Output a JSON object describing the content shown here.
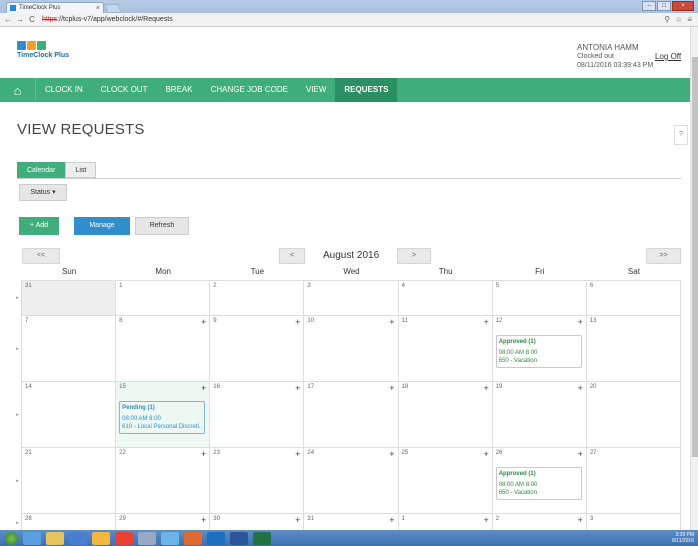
{
  "browser": {
    "tab_title": "TimeClock Plus",
    "url_scheme": "https",
    "url_rest": "://tcplus-v7/app/webclock/#/Requests"
  },
  "header": {
    "logo_text": "TimeClock Plus",
    "user_name": "ANTONIA HAMM",
    "user_status": "Clocked out",
    "datetime": "08/11/2016 03:39:43 PM",
    "logoff": "Log Off"
  },
  "nav": {
    "items": [
      {
        "label": "CLOCK IN"
      },
      {
        "label": "CLOCK OUT"
      },
      {
        "label": "BREAK"
      },
      {
        "label": "CHANGE JOB CODE"
      },
      {
        "label": "VIEW"
      },
      {
        "label": "REQUESTS",
        "active": true
      }
    ]
  },
  "page": {
    "title": "VIEW REQUESTS",
    "help": "?",
    "tabs": [
      {
        "label": "Calendar",
        "active": true
      },
      {
        "label": "List"
      }
    ],
    "status_label": "Status",
    "add_label": "Add",
    "manage_label": "Manage",
    "refresh_label": "Refresh",
    "prev_year": "<<",
    "prev_month": "<",
    "next_month": ">",
    "next_year": ">>",
    "month_title": "August 2016"
  },
  "weekdays": [
    "Sun",
    "Mon",
    "Tue",
    "Wed",
    "Thu",
    "Fri",
    "Sat"
  ],
  "colors": {
    "brand_green": "#3fae7c",
    "manage_blue": "#2f8ecb",
    "approved_green": "#2e8b3d",
    "pending_blue": "#2f8ecb"
  },
  "calendar": {
    "weeks": [
      {
        "days": [
          {
            "n": "31",
            "gray": true
          },
          {
            "n": "1"
          },
          {
            "n": "2"
          },
          {
            "n": "3"
          },
          {
            "n": "4"
          },
          {
            "n": "5"
          },
          {
            "n": "6"
          }
        ]
      },
      {
        "days": [
          {
            "n": "7"
          },
          {
            "n": "8",
            "plus": true
          },
          {
            "n": "9",
            "plus": true
          },
          {
            "n": "10",
            "plus": true
          },
          {
            "n": "11",
            "plus": true
          },
          {
            "n": "12",
            "plus": true,
            "event": {
              "status": "approved",
              "head": "Approved (1)",
              "lines": [
                "08:00 AM 8:00",
                "650 - Vacation"
              ]
            }
          },
          {
            "n": "13"
          }
        ]
      },
      {
        "days": [
          {
            "n": "14"
          },
          {
            "n": "15",
            "plus": true,
            "today": true,
            "event": {
              "status": "pending",
              "head": "Pending (1)",
              "lines": [
                "08:00 AM 8:00",
                "610 - Local Personal Discreti..."
              ]
            }
          },
          {
            "n": "16",
            "plus": true
          },
          {
            "n": "17",
            "plus": true
          },
          {
            "n": "18",
            "plus": true
          },
          {
            "n": "19",
            "plus": true
          },
          {
            "n": "20"
          }
        ]
      },
      {
        "days": [
          {
            "n": "21"
          },
          {
            "n": "22",
            "plus": true
          },
          {
            "n": "23",
            "plus": true
          },
          {
            "n": "24",
            "plus": true
          },
          {
            "n": "25",
            "plus": true
          },
          {
            "n": "26",
            "plus": true,
            "event": {
              "status": "approved",
              "head": "Approved (1)",
              "lines": [
                "08:00 AM 8:00",
                "650 - Vacation"
              ]
            }
          },
          {
            "n": "27"
          }
        ]
      },
      {
        "days": [
          {
            "n": "28"
          },
          {
            "n": "29",
            "plus": true
          },
          {
            "n": "30",
            "plus": true
          },
          {
            "n": "31",
            "plus": true
          },
          {
            "n": "1",
            "plus": true
          },
          {
            "n": "2",
            "plus": true
          },
          {
            "n": "3"
          }
        ]
      }
    ]
  },
  "taskbar": {
    "time": "3:39 PM",
    "date": "8/11/2016"
  }
}
